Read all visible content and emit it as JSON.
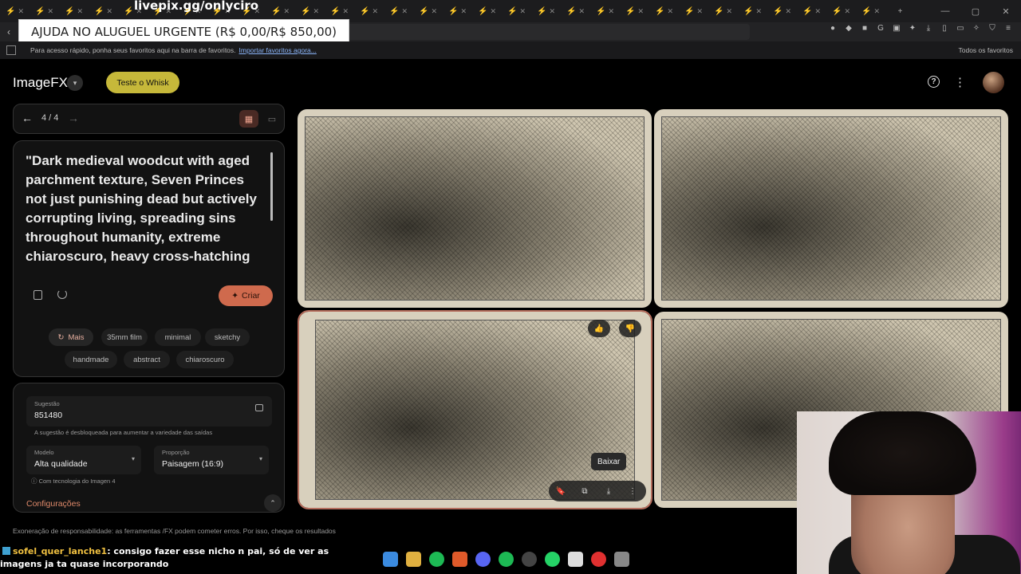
{
  "overlay": {
    "stream_url": "livepix.gg/onlyciro",
    "banner": "AJUDA NO ALUGUEL URGENTE (R$ 0,00/R$ 850,00)"
  },
  "browser": {
    "tab_count": 30,
    "bookmarks_prompt": "Para acesso rápido, ponha seus favoritos aqui na barra de favoritos.",
    "bookmarks_import": "Importar favoritos agora...",
    "all_favorites": "Todos os favoritos"
  },
  "app": {
    "title": "ImageFX",
    "title_dropdown": "▾",
    "try_whisk": "Teste o Whisk",
    "help": "?",
    "more": "⋮"
  },
  "pager": {
    "prev": "←",
    "count": "4 / 4",
    "next": "→",
    "grid_icon": "▦",
    "single_icon": "▭"
  },
  "prompt": {
    "text": "\"Dark medieval woodcut with aged parchment texture, Seven Princes not just punishing dead but actively corrupting living, spreading sins throughout humanity, extreme chiaroscuro, heavy cross-hatching",
    "create_label": "Criar",
    "create_icon": "✦"
  },
  "chips": {
    "more": "Mais",
    "items": [
      "35mm film",
      "minimal",
      "sketchy",
      "handmade",
      "abstract",
      "chiaroscuro"
    ]
  },
  "settings": {
    "seed_label": "Sugestão",
    "seed_value": "851480",
    "seed_hint": "A sugestão é desbloqueada para aumentar a variedade das saídas",
    "model_label": "Modelo",
    "model_value": "Alta qualidade",
    "ratio_label": "Proporção",
    "ratio_value": "Paisagem (16:9)",
    "tech_note": "Com tecnologia do Imagen 4",
    "config_label": "Configurações",
    "caret": "▾",
    "toggle": "⌃"
  },
  "disclaimer": "Exoneração de responsabilidade: as ferramentas /FX podem cometer erros. Por isso, cheque os resultados",
  "image_actions": {
    "like": "👍",
    "dislike": "👎",
    "download_tooltip": "Baixar",
    "toolbar": [
      "🔖",
      "⧉",
      "⤓",
      "⋮"
    ]
  },
  "chat": {
    "user": "sofel_quer_lanche1",
    "message": ": consigo fazer esse nicho n pai, só de ver as imagens ja ta quase incorporando"
  }
}
